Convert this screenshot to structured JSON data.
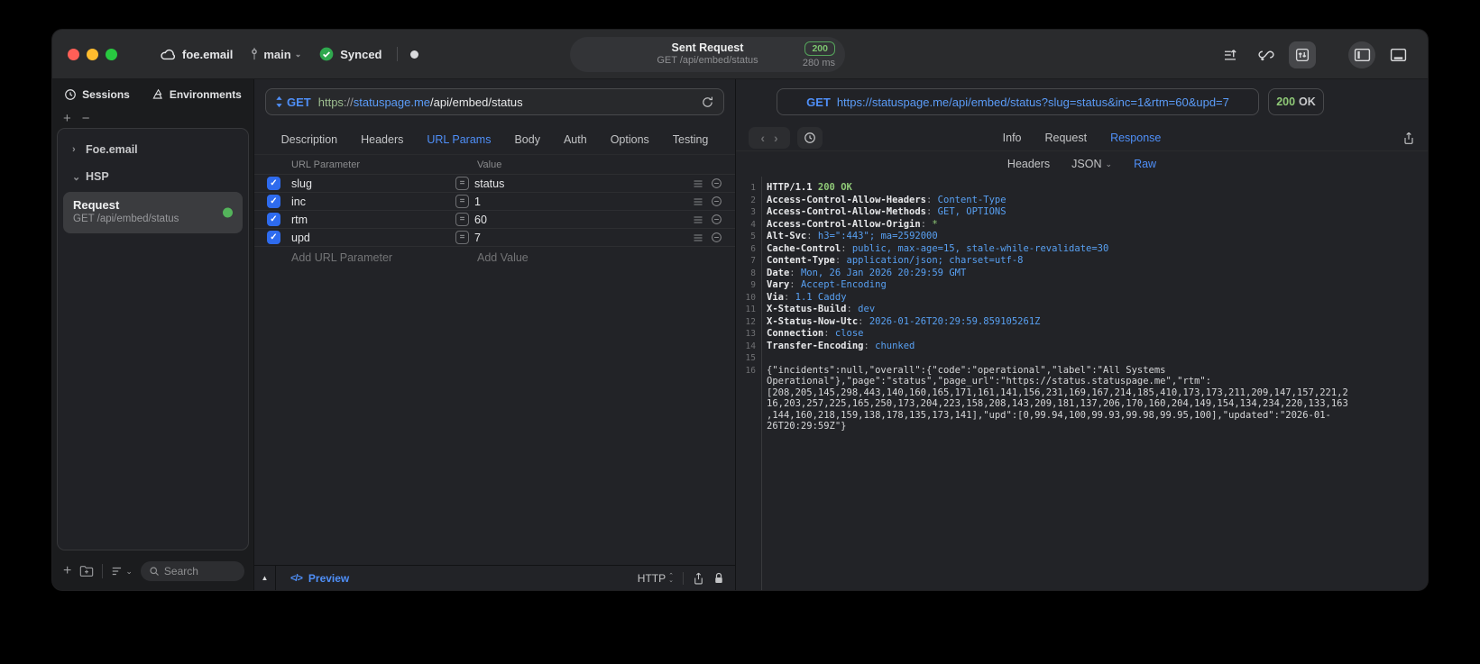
{
  "titlebar": {
    "project": "foe.email",
    "branch": "main",
    "sync": "Synced",
    "request_title": "Sent Request",
    "request_subtitle": "GET /api/embed/status",
    "status_code": "200",
    "duration": "280 ms"
  },
  "sidebar": {
    "tab_sessions": "Sessions",
    "tab_environments": "Environments",
    "group_foe": "Foe.email",
    "group_hsp": "HSP",
    "request_title": "Request",
    "request_subtitle": "GET /api/embed/status",
    "search_placeholder": "Search"
  },
  "request_pane": {
    "method": "GET",
    "url_scheme": "https",
    "url_sep": "://",
    "url_host": "statuspage.me",
    "url_path": "/api/embed/status",
    "tabs": {
      "description": "Description",
      "headers": "Headers",
      "url_params": "URL Params",
      "body": "Body",
      "auth": "Auth",
      "options": "Options",
      "testing": "Testing"
    },
    "table": {
      "col_param": "URL Parameter",
      "col_value": "Value",
      "eq": "=",
      "check": "✓",
      "rows": [
        {
          "name": "slug",
          "value": "status"
        },
        {
          "name": "inc",
          "value": "1"
        },
        {
          "name": "rtm",
          "value": "60"
        },
        {
          "name": "upd",
          "value": "7"
        }
      ],
      "add_param": "Add URL Parameter",
      "add_value": "Add Value"
    },
    "footer": {
      "preview": "Preview",
      "code_glyph": "</>",
      "protocol": "HTTP"
    }
  },
  "response_pane": {
    "method": "GET",
    "url": "https://statuspage.me/api/embed/status?slug=status&inc=1&rtm=60&upd=7",
    "status_code": "200",
    "status_text": "OK",
    "tabs": {
      "info": "Info",
      "request": "Request",
      "response": "Response"
    },
    "subtabs": {
      "headers": "Headers",
      "json": "JSON",
      "raw": "Raw"
    },
    "status_line": {
      "num": "1",
      "proto": "HTTP/1.1 ",
      "status": "200 OK"
    },
    "headers": [
      {
        "num": "2",
        "name": "Access-Control-Allow-Headers",
        "sep": ": ",
        "value": "Content-Type"
      },
      {
        "num": "3",
        "name": "Access-Control-Allow-Methods",
        "sep": ": ",
        "value": "GET, OPTIONS"
      },
      {
        "num": "4",
        "name": "Access-Control-Allow-Origin",
        "sep": ": ",
        "value": "*"
      },
      {
        "num": "5",
        "name": "Alt-Svc",
        "sep": ": ",
        "value": "h3=\":443\"; ma=2592000"
      },
      {
        "num": "6",
        "name": "Cache-Control",
        "sep": ": ",
        "value": "public, max-age=15, stale-while-revalidate=30"
      },
      {
        "num": "7",
        "name": "Content-Type",
        "sep": ": ",
        "value": "application/json; charset=utf-8"
      },
      {
        "num": "8",
        "name": "Date",
        "sep": ": ",
        "value": "Mon, 26 Jan 2026 20:29:59 GMT"
      },
      {
        "num": "9",
        "name": "Vary",
        "sep": ": ",
        "value": "Accept-Encoding"
      },
      {
        "num": "10",
        "name": "Via",
        "sep": ": ",
        "value": "1.1 Caddy"
      },
      {
        "num": "11",
        "name": "X-Status-Build",
        "sep": ": ",
        "value": "dev"
      },
      {
        "num": "12",
        "name": "X-Status-Now-Utc",
        "sep": ": ",
        "value": "2026-01-26T20:29:59.859105261Z"
      },
      {
        "num": "13",
        "name": "Connection",
        "sep": ": ",
        "value": "close"
      },
      {
        "num": "14",
        "name": "Transfer-Encoding",
        "sep": ": ",
        "value": "chunked"
      }
    ],
    "blank_line_num": "15",
    "body": {
      "num": "16",
      "text": "{\"incidents\":null,\"overall\":{\"code\":\"operational\",\"label\":\"All Systems Operational\"},\"page\":\"status\",\"page_url\":\"https://status.statuspage.me\",\"rtm\":[208,205,145,298,443,140,160,165,171,161,141,156,231,169,167,214,185,410,173,173,211,209,147,157,221,216,203,257,225,165,250,173,204,223,158,208,143,209,181,137,206,170,160,204,149,154,134,234,220,133,163,144,160,218,159,138,178,135,173,141],\"upd\":[0,99.94,100,99.93,99.98,99.95,100],\"updated\":\"2026-01-26T20:29:59Z\"}"
    }
  },
  "colors": {
    "accent_blue": "#4f8ff8",
    "status_green": "#8fc977",
    "checkbox_blue": "#2e6bee",
    "indicator_green": "#54b45b"
  }
}
